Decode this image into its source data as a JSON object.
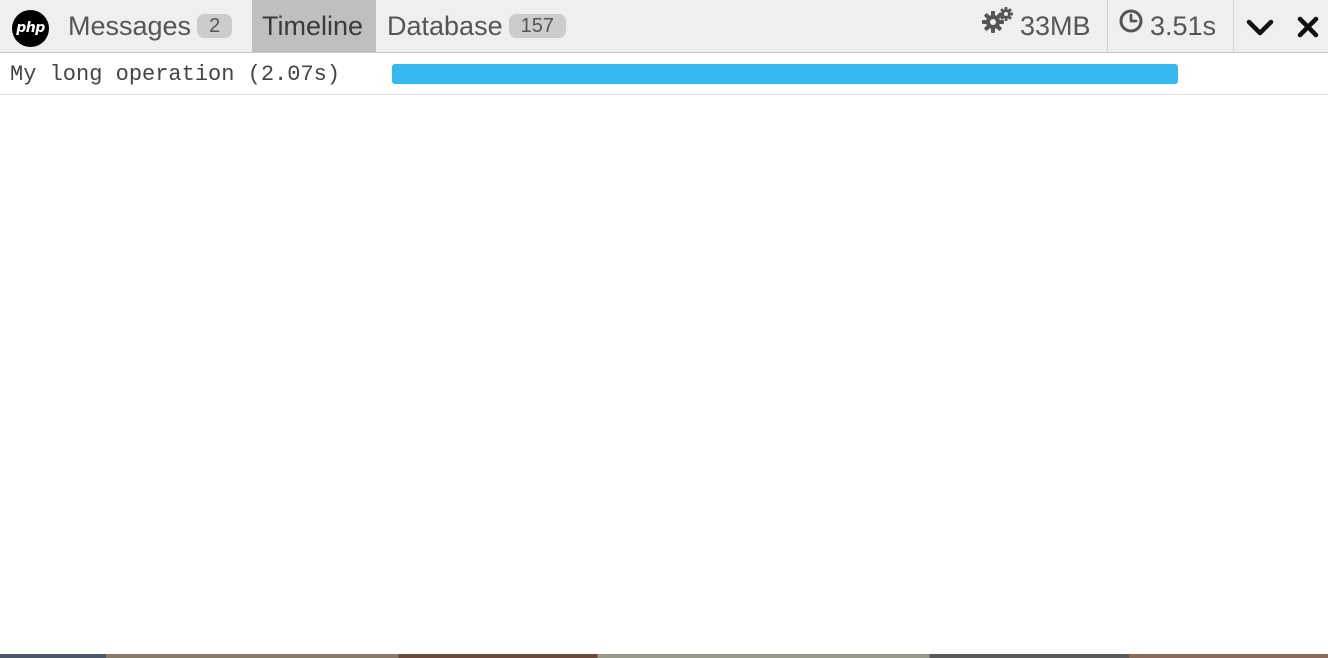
{
  "logo": {
    "text": "php"
  },
  "tabs": [
    {
      "label": "Messages",
      "badge": "2",
      "active": false
    },
    {
      "label": "Timeline",
      "badge": null,
      "active": true
    },
    {
      "label": "Database",
      "badge": "157",
      "active": false
    }
  ],
  "indicators": {
    "memory": {
      "icon": "gears-icon",
      "value": "33MB"
    },
    "time": {
      "icon": "clock-icon",
      "value": "3.51s"
    }
  },
  "controls": {
    "minimize_icon": "chevron-down-icon",
    "close_icon": "close-icon"
  },
  "timeline": {
    "measures": [
      {
        "label": "My long operation (2.07s)",
        "bar_color": "#35b8f0",
        "bar_fraction": 1.0
      }
    ]
  },
  "colors": {
    "accent": "#35b8f0",
    "header_bg": "#efefef",
    "active_tab_bg": "#bfbfbf"
  }
}
